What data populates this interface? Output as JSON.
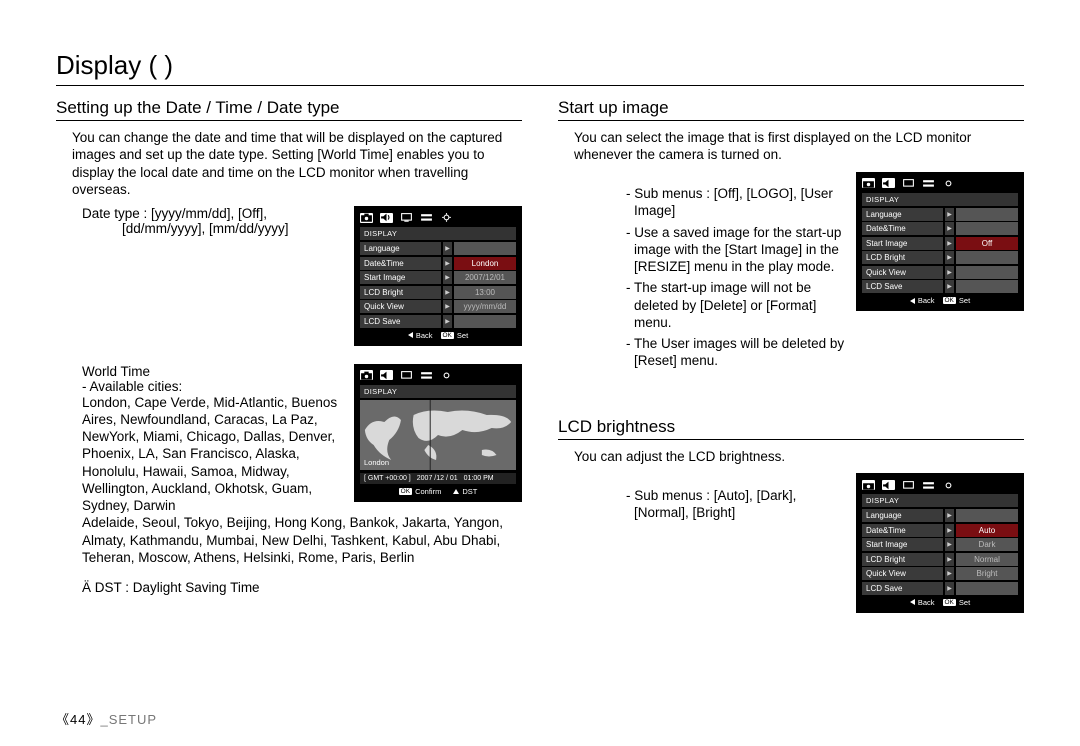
{
  "page_title": "Display (        )",
  "footer": {
    "page_num": "《44》",
    "section": "_SETUP"
  },
  "left": {
    "section1_title": "Setting up the Date / Time / Date type",
    "section1_para": "You can change the date and time that will be displayed on the captured images and set up the date type. Setting [World Time] enables you to display the local date and time on the LCD monitor when travelling overseas.",
    "date_type_line1": "Date type : [yyyy/mm/dd], [Off],",
    "date_type_line2": "[dd/mm/yyyy], [mm/dd/yyyy]",
    "world_time_label": "World Time",
    "cities_label": "- Available cities:",
    "cities_block": "London, Cape Verde, Mid-Atlantic, Buenos Aires, Newfoundland, Caracas, La Paz, NewYork, Miami, Chicago, Dallas, Denver, Phoenix, LA, San Francisco, Alaska, Honolulu, Hawaii, Samoa, Midway, Wellington, Auckland, Okhotsk, Guam, Sydney, Darwin",
    "cities_rest": "Adelaide, Seoul, Tokyo, Beijing, Hong Kong, Bankok, Jakarta, Yangon, Almaty, Kathmandu, Mumbai, New Delhi, Tashkent, Kabul, Abu Dhabi, Teheran, Moscow, Athens, Helsinki, Rome, Paris, Berlin",
    "dst_note": "Ä DST : Daylight Saving Time"
  },
  "right": {
    "section2_title": "Start up image",
    "section2_para": "You can select the image that is ﬁrst displayed on the LCD monitor whenever the camera is turned on.",
    "startup_bullets": [
      "- Sub menus : [Off], [LOGO], [User Image]",
      "- Use a saved image for the start-up image with the [Start Image] in the [RESIZE] menu in the play mode.",
      "- The start-up image will not be deleted by [Delete] or [Format] menu.",
      "- The User images will be deleted by [Reset] menu."
    ],
    "section3_title": "LCD brightness",
    "section3_para": "You can adjust the LCD brightness.",
    "lcd_bullet": "- Sub menus : [Auto], [Dark], [Normal], [Bright]"
  },
  "menus": {
    "header": "DISPLAY",
    "labels": [
      "Language",
      "Date&Time",
      "Start Image",
      "LCD Bright",
      "Quick View",
      "LCD Save"
    ],
    "footer_back": "Back",
    "footer_ok": "OK",
    "footer_set": "Set",
    "footer_confirm": "Confirm",
    "footer_dst": "DST",
    "screen1_values": {
      "val1": "London",
      "val2": "2007/12/01",
      "val3": "13:00",
      "val4": "yyyy/mm/dd"
    },
    "screen2_values": {
      "val1": "Off"
    },
    "screen3_values": {
      "val1": "Auto",
      "val2": "Dark",
      "val3": "Normal",
      "val4": "Bright"
    },
    "worldtime": {
      "city": "London",
      "info_gmt": "[ GMT +00:00 ]",
      "info_date": "2007 /12 / 01",
      "info_time": "01:00 PM"
    }
  }
}
